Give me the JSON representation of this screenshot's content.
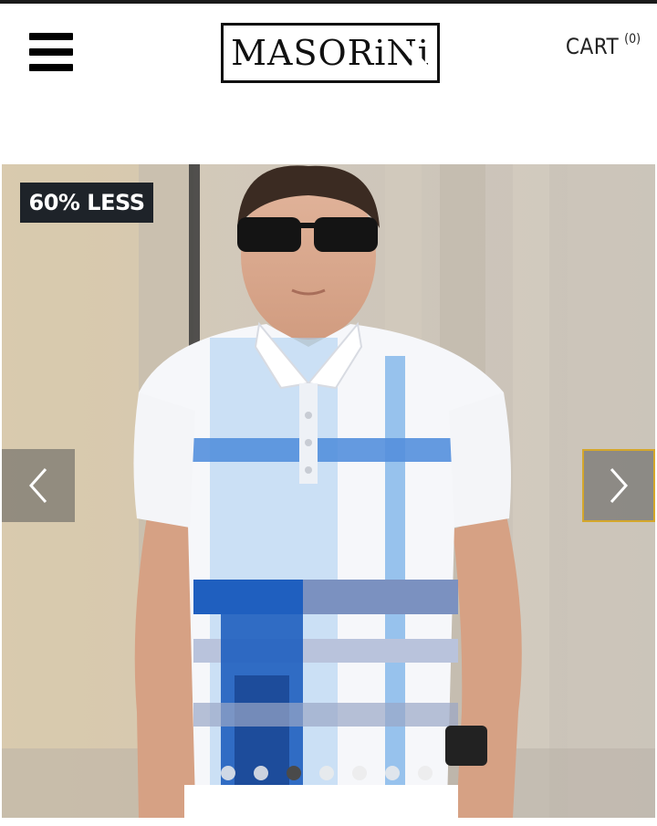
{
  "header": {
    "logo_text": "MASORiNi",
    "cart_label": "CART",
    "cart_count": "(0)"
  },
  "icons": {
    "menu": "hamburger-menu-icon",
    "prev": "chevron-left-icon",
    "next": "chevron-right-icon"
  },
  "carousel": {
    "badge": "60% LESS",
    "slide_count": 7,
    "active_slide": 3
  },
  "colors": {
    "badge_bg": "#1e2329",
    "next_arrow_border": "#d4a72c",
    "shirt_blue": "#1f5fbf",
    "shirt_light_blue": "#9cc6ee"
  }
}
